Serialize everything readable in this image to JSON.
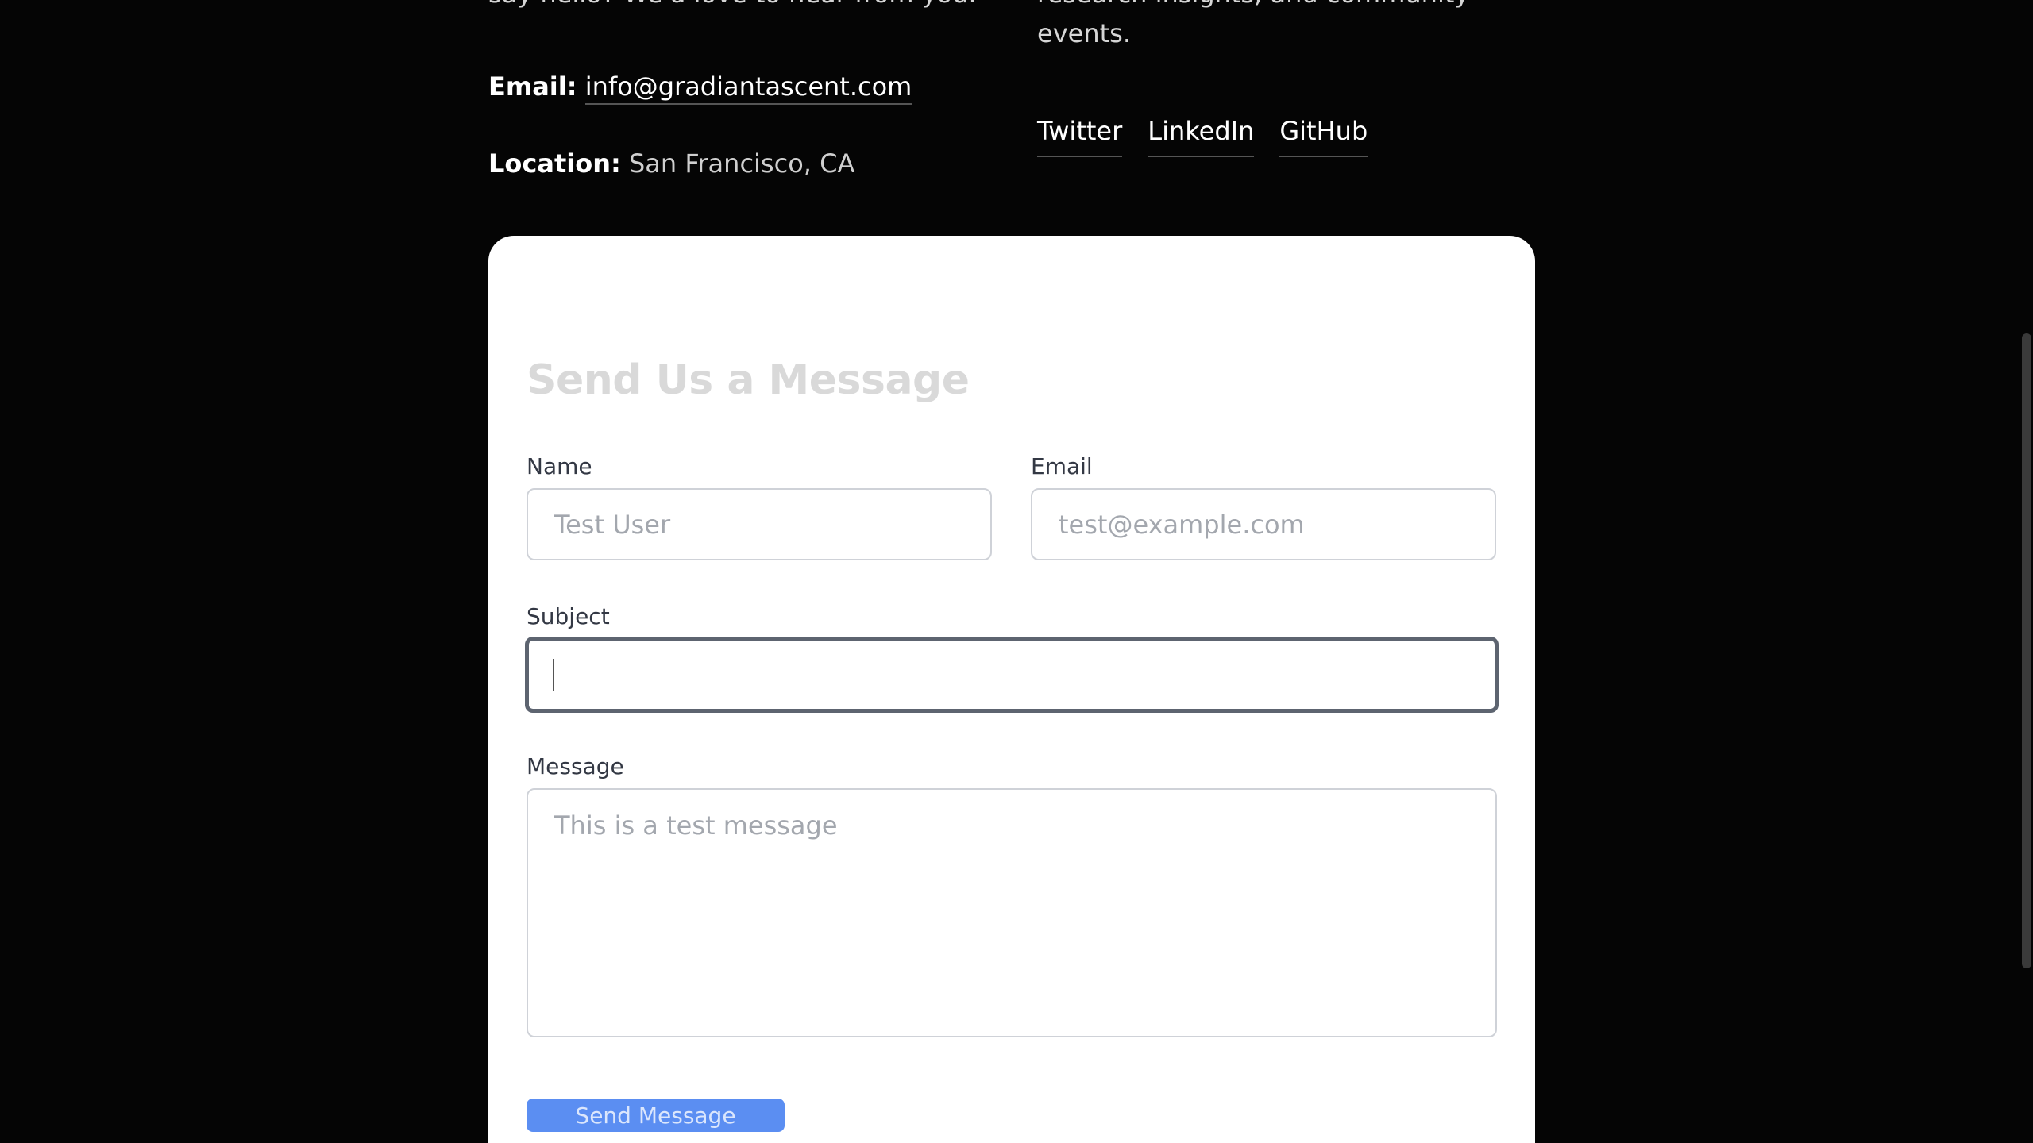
{
  "contact_info": {
    "intro_tail": "say hello? We'd love to hear from you.",
    "email_label": "Email:",
    "email_value": "info@gradiantascent.com",
    "location_label": "Location:",
    "location_value": "San Francisco, CA"
  },
  "community": {
    "text_tail": "research insights, and community events.",
    "links": [
      "Twitter",
      "LinkedIn",
      "GitHub"
    ]
  },
  "form": {
    "title": "Send Us a Message",
    "name_label": "Name",
    "name_placeholder": "Test User",
    "email_label": "Email",
    "email_placeholder": "test@example.com",
    "subject_label": "Subject",
    "subject_value": "",
    "message_label": "Message",
    "message_placeholder": "This is a test message",
    "submit_label": "Send Message"
  },
  "colors": {
    "background": "#050505",
    "card": "#ffffff",
    "button": "#5b8ef2"
  }
}
